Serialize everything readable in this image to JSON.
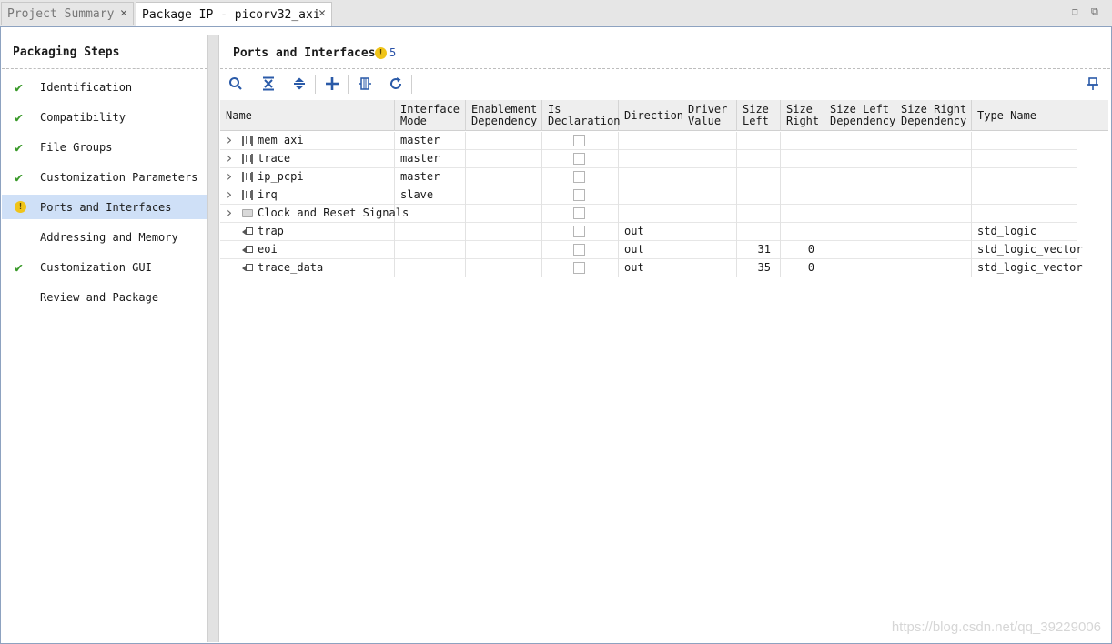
{
  "tabs": [
    {
      "label": "Project Summary"
    },
    {
      "label": "Package IP - picorv32_axi"
    }
  ],
  "sidebar": {
    "title": "Packaging Steps",
    "items": [
      {
        "label": "Identification",
        "status": "check"
      },
      {
        "label": "Compatibility",
        "status": "check"
      },
      {
        "label": "File Groups",
        "status": "check"
      },
      {
        "label": "Customization Parameters",
        "status": "check"
      },
      {
        "label": "Ports and Interfaces",
        "status": "warning",
        "selected": true
      },
      {
        "label": "Addressing and Memory",
        "status": "none"
      },
      {
        "label": "Customization GUI",
        "status": "check"
      },
      {
        "label": "Review and Package",
        "status": "none"
      }
    ]
  },
  "main": {
    "title": "Ports and Interfaces",
    "warning_count": "5",
    "toolbar": [
      "search-icon",
      "collapse-all-icon",
      "expand-all-icon",
      "add-icon",
      "bus-interface-icon",
      "refresh-icon",
      "pin-icon"
    ],
    "columns": [
      "Name",
      "Interface Mode",
      "Enablement Dependency",
      "Is Declaration",
      "Direction",
      "Driver Value",
      "Size Left",
      "Size Right",
      "Size Left Dependency",
      "Size Right Dependency",
      "Type Name"
    ],
    "rows": [
      {
        "name": "mem_axi",
        "kind": "bus",
        "mode": "master",
        "direction": "",
        "size_left": "",
        "size_right": "",
        "type": ""
      },
      {
        "name": "trace",
        "kind": "bus",
        "mode": "master",
        "direction": "",
        "size_left": "",
        "size_right": "",
        "type": ""
      },
      {
        "name": "ip_pcpi",
        "kind": "bus",
        "mode": "master",
        "direction": "",
        "size_left": "",
        "size_right": "",
        "type": ""
      },
      {
        "name": "irq",
        "kind": "bus",
        "mode": "slave",
        "direction": "",
        "size_left": "",
        "size_right": "",
        "type": ""
      },
      {
        "name": "Clock and Reset Signals",
        "kind": "folder",
        "mode": "",
        "direction": "",
        "size_left": "",
        "size_right": "",
        "type": ""
      },
      {
        "name": "trap",
        "kind": "port",
        "mode": "",
        "direction": "out",
        "size_left": "",
        "size_right": "",
        "type": "std_logic"
      },
      {
        "name": "eoi",
        "kind": "port",
        "mode": "",
        "direction": "out",
        "size_left": "31",
        "size_right": "0",
        "type": "std_logic_vector"
      },
      {
        "name": "trace_data",
        "kind": "port",
        "mode": "",
        "direction": "out",
        "size_left": "35",
        "size_right": "0",
        "type": "std_logic_vector"
      }
    ]
  },
  "watermark": "https://blog.csdn.net/qq_39229006"
}
